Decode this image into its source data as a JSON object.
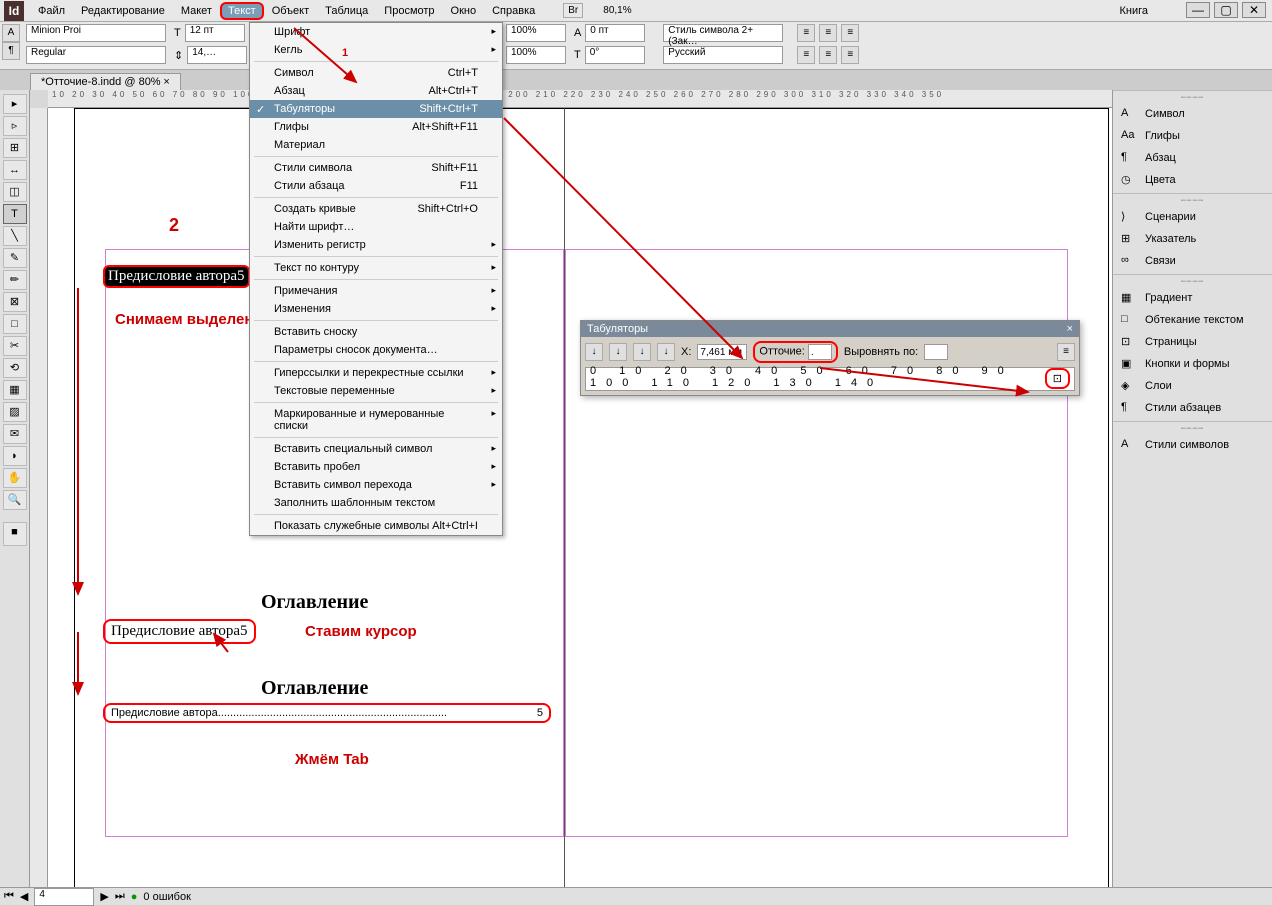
{
  "app": {
    "logo": "Id",
    "zoom": "80,1%",
    "book": "Книга"
  },
  "menu": [
    "Файл",
    "Редактирование",
    "Макет",
    "Текст",
    "Объект",
    "Таблица",
    "Просмотр",
    "Окно",
    "Справка"
  ],
  "menu_active_idx": 3,
  "controls": {
    "font": "Minion Proi",
    "style": "Regular",
    "size": "12 пт",
    "leading": "14,…",
    "scale_h": "100%",
    "scale_v": "100%",
    "baseline": "0 пт",
    "skew": "0°",
    "charstyle": "Стиль символа 2+ (Зак…",
    "lang": "Русский"
  },
  "doc_tab": "*Отточие-8.indd @ 80%",
  "dropdown": [
    {
      "t": "Шрифт",
      "sub": true
    },
    {
      "t": "Кегль",
      "sub": true
    },
    {
      "sep": true
    },
    {
      "t": "Символ",
      "sc": "Ctrl+T"
    },
    {
      "t": "Абзац",
      "sc": "Alt+Ctrl+T"
    },
    {
      "t": "Табуляторы",
      "sc": "Shift+Ctrl+T",
      "hl": true,
      "chk": true
    },
    {
      "t": "Глифы",
      "sc": "Alt+Shift+F11"
    },
    {
      "t": "Материал"
    },
    {
      "sep": true
    },
    {
      "t": "Стили символа",
      "sc": "Shift+F11"
    },
    {
      "t": "Стили абзаца",
      "sc": "F11"
    },
    {
      "sep": true
    },
    {
      "t": "Создать кривые",
      "sc": "Shift+Ctrl+O"
    },
    {
      "t": "Найти шрифт…"
    },
    {
      "t": "Изменить регистр",
      "sub": true
    },
    {
      "sep": true
    },
    {
      "t": "Текст по контуру",
      "sub": true
    },
    {
      "sep": true
    },
    {
      "t": "Примечания",
      "sub": true
    },
    {
      "t": "Изменения",
      "sub": true
    },
    {
      "sep": true
    },
    {
      "t": "Вставить сноску"
    },
    {
      "t": "Параметры сносок документа…"
    },
    {
      "sep": true
    },
    {
      "t": "Гиперссылки и перекрестные ссылки",
      "sub": true
    },
    {
      "t": "Текстовые переменные",
      "sub": true
    },
    {
      "sep": true
    },
    {
      "t": "Маркированные и нумерованные списки",
      "sub": true
    },
    {
      "sep": true
    },
    {
      "t": "Вставить специальный символ",
      "sub": true
    },
    {
      "t": "Вставить пробел",
      "sub": true
    },
    {
      "t": "Вставить символ перехода",
      "sub": true
    },
    {
      "t": "Заполнить шаблонным текстом"
    },
    {
      "sep": true
    },
    {
      "t": "Показать служебные символы",
      "sc": "Alt+Ctrl+I"
    }
  ],
  "tabpanel": {
    "title": "Табуляторы",
    "x_label": "X:",
    "x_val": "7,461 мм",
    "leader_label": "Отточие:",
    "leader_val": ".",
    "align_label": "Выровнять по:",
    "ruler": "0 10 20 30 40 50 60 70 80 90 100 110 120 130 140"
  },
  "rpanel": [
    [
      {
        "l": "Символ",
        "i": "A"
      },
      {
        "l": "Глифы",
        "i": "Aa"
      },
      {
        "l": "Абзац",
        "i": "¶"
      },
      {
        "l": "Цвета",
        "i": "◷"
      }
    ],
    [
      {
        "l": "Сценарии",
        "i": "⟩"
      },
      {
        "l": "Указатель",
        "i": "⊞"
      },
      {
        "l": "Связи",
        "i": "∞"
      }
    ],
    [
      {
        "l": "Градиент",
        "i": "▦"
      },
      {
        "l": "Обтекание текстом",
        "i": "□"
      },
      {
        "l": "Страницы",
        "i": "⊡"
      },
      {
        "l": "Кнопки и формы",
        "i": "▣"
      },
      {
        "l": "Слои",
        "i": "◈"
      },
      {
        "l": "Стили абзацев",
        "i": "¶"
      }
    ],
    [
      {
        "l": "Стили символов",
        "i": "A"
      }
    ]
  ],
  "page": {
    "heading": "Оглавление",
    "heading_partial": "Огл",
    "sel_text": "Предисловие автора5",
    "cursor_text": "Предисловие автора5",
    "tab_text_pre": "Предисловие автора",
    "tab_text_num": "5",
    "dots": "...........................................................................",
    "ann1_num": "1",
    "ann2_num": "2",
    "ann_deselect": "Снимаем выделение",
    "ann_cursor": "Ставим курсор",
    "ann_tab": "Жмём Tab"
  },
  "status": {
    "pg": "4",
    "err": "0 ошибок"
  },
  "win": {
    "min": "—",
    "max": "▢",
    "close": "✕"
  },
  "hruler_ticks": "10 20 30 40 50 60 70 80 90 100 110 120 130 140 150 160 170 180 190 200 210 220 230 240 250 260 270 280 290 300 310 320 330 340 350"
}
